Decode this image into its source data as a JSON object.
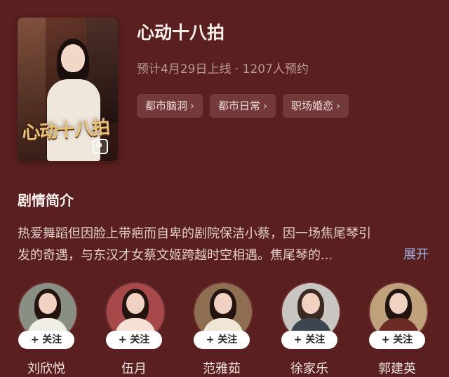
{
  "show": {
    "title": "心动十八拍",
    "poster_title_art": "心动十八拍",
    "meta": "预计4月29日上线 · 1207人预约",
    "tags": [
      {
        "label": "都市脑洞"
      },
      {
        "label": "都市日常"
      },
      {
        "label": "职场婚恋"
      }
    ],
    "tag_chevron": "›"
  },
  "synopsis": {
    "heading": "剧情简介",
    "line1": "热爱舞蹈但因脸上带疤而自卑的剧院保洁小蔡，因一场焦尾琴引",
    "line2": "发的奇遇，与东汉才女蔡文姬跨越时空相遇。焦尾琴的...",
    "expand_label": "展开"
  },
  "cast": {
    "follow_label": "+ 关注",
    "members": [
      {
        "name": "刘欣悦",
        "avatar_bg": "#8a8f86",
        "body_color": "#f0ece6"
      },
      {
        "name": "伍月",
        "avatar_bg": "#a7494b",
        "body_color": "#f5e1d6"
      },
      {
        "name": "范雅茹",
        "avatar_bg": "#8f6f52",
        "body_color": "#efe6d6"
      },
      {
        "name": "徐家乐",
        "avatar_bg": "#c9c6c2",
        "body_color": "#3d4650"
      },
      {
        "name": "郭建英",
        "avatar_bg": "#bfa27c",
        "body_color": "#6b2a24"
      }
    ]
  },
  "icons": {
    "tag_chevron": "chevron-right-icon",
    "poster_badge": "image-gallery-icon"
  }
}
